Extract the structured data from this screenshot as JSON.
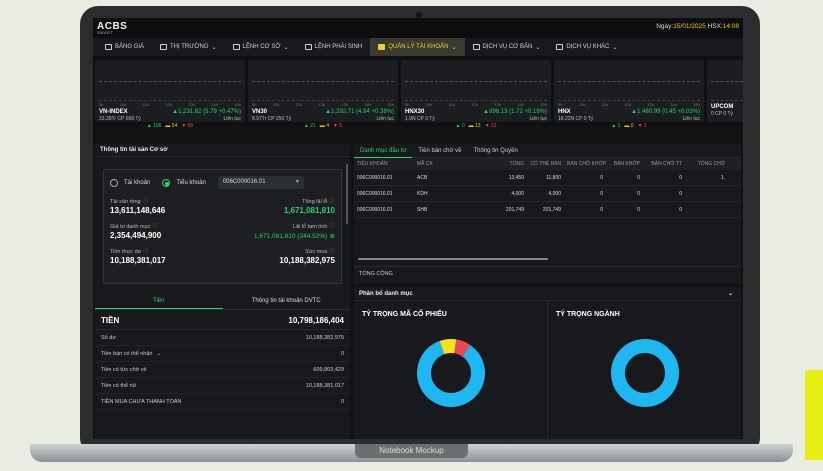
{
  "mockup_label": "Notebook Mockup",
  "app": {
    "logo": "ACBS",
    "logo_sub": "SMART"
  },
  "header": {
    "date_prefix": "Ngày:",
    "date": "15/01/2025",
    "exchange": "HSX:",
    "time": "14:08"
  },
  "nav": [
    {
      "label": "BẢNG GIÁ",
      "icon": "monitor-icon"
    },
    {
      "label": "THỊ TRƯỜNG",
      "icon": "chart-icon",
      "dropdown": true
    },
    {
      "label": "LỆNH CƠ SỞ",
      "icon": "trend-icon",
      "dropdown": true
    },
    {
      "label": "LỆNH PHÁI SINH",
      "icon": "trend-icon"
    },
    {
      "label": "QUẢN LÝ TÀI KHOẢN",
      "icon": "folder-icon",
      "dropdown": true,
      "active": true
    },
    {
      "label": "DỊCH VỤ CƠ BẢN",
      "icon": "grid-icon",
      "dropdown": true
    },
    {
      "label": "DỊCH VỤ KHÁC",
      "icon": "service-icon",
      "dropdown": true
    }
  ],
  "indices": [
    {
      "name": "VN-INDEX",
      "change": "▲1,231.82 (5.79 +0.47%)",
      "vol": "33.39Tr CP",
      "value": "668 Tỷ",
      "session": "Liên tục",
      "up": "196",
      "ref": "54",
      "down": "85",
      "ticks": [
        "9h",
        "10h",
        "11h",
        "12h",
        "13h",
        "14h",
        "15h"
      ]
    },
    {
      "name": "VN30",
      "change": "▲1,292.71 (4.94 +0.38%)",
      "vol": "8.97Tr CP",
      "value": "250 Tỷ",
      "session": "Liên tục",
      "up": "21",
      "ref": "4",
      "down": "5",
      "ticks": [
        "9h",
        "10h",
        "11h",
        "12h",
        "13h",
        "14h",
        "15h"
      ]
    },
    {
      "name": "HNX30",
      "change": "▲896.13 (1.72 +0.19%)",
      "vol": "1.9N CP",
      "value": "0 Tỷ",
      "session": "Liên tục",
      "up": "0",
      "ref": "13",
      "down": "12",
      "ticks": [
        "9h",
        "10h",
        "11h",
        "12h",
        "13h",
        "14h",
        "15h"
      ]
    },
    {
      "name": "HNX",
      "change": "▲1,460.99 (0.45 +0.03%)",
      "vol": "18.22N CP",
      "value": "0 Tỷ",
      "session": "Liên tục",
      "up": "1",
      "ref": "0",
      "down": "3",
      "ticks": [
        "9h",
        "10h",
        "11h",
        "12h",
        "13h",
        "14h",
        "15h"
      ]
    },
    {
      "name": "UPCOM",
      "change": "",
      "vol": "0 CP",
      "value": "0 Tỷ",
      "session": "",
      "up": "",
      "ref": "",
      "down": "",
      "ticks": []
    }
  ],
  "asset_panel": {
    "title": "Thông tin tài sản Cơ sở",
    "radio_account": "Tài khoản",
    "radio_subaccount": "Tiểu khoản",
    "account_value": "006C000016.01",
    "net_assets_label": "Tài sản ròng",
    "net_assets": "13,611,148,646",
    "total_pl_label": "Tổng lãi lỗ",
    "total_pl": "1,671,081,810",
    "portfolio_label": "Giá trị danh mục",
    "portfolio": "2,354,494,900",
    "temp_pl_label": "Lãi lỗ tạm tính",
    "temp_pl": "1,671,081,810 (244.52%)",
    "cash_label": "Tiền thực dư",
    "cash": "10,188,381,017",
    "buying_power_label": "Sức mua",
    "buying_power": "10,188,382,975",
    "tabs": [
      "Tiền",
      "Thông tin tài khoản DVTC"
    ],
    "money_title": "TIỀN",
    "money_total": "10,798,186,404",
    "rows": [
      {
        "label": "Số dư",
        "value": "10,188,382,975"
      },
      {
        "label": "Tiền bán có thể nhận",
        "value": "0",
        "expand": true
      },
      {
        "label": "Tiền có tức chờ về",
        "value": "609,803,429"
      },
      {
        "label": "Tiền có thể rút",
        "value": "10,188,381,017"
      },
      {
        "label": "TIỀN MUA CHƯA THANH TOÁN",
        "value": "0"
      }
    ]
  },
  "portfolio_panel": {
    "tabs": [
      "Danh mục đầu tư",
      "Tiền bán chờ về",
      "Thông tin Quyền"
    ],
    "headers": [
      "TIỂU KHOẢN",
      "MÃ CK",
      "TỔNG",
      "CÓ THỂ BÁN",
      "BÁN CHỜ KHỚP",
      "BÁN KHỚP",
      "BÁN CHỜ TT",
      "TỔNG CHỜ"
    ],
    "rows": [
      [
        "006C000016.01",
        "ACB",
        "13,450",
        "11,800",
        "0",
        "0",
        "0",
        "1,"
      ],
      [
        "006C000016.01",
        "KDH",
        "4,000",
        "4,000",
        "0",
        "0",
        "0",
        ""
      ],
      [
        "006C000016.01",
        "SHB",
        "201,749",
        "201,749",
        "0",
        "0",
        "0",
        ""
      ]
    ],
    "total_label": "TỔNG CỘNG"
  },
  "allocation": {
    "title": "Phân bổ danh mục",
    "stock_title": "TỶ TRỌNG MÃ CỔ PHIẾU",
    "sector_title": "TỶ TRỌNG NGÀNH",
    "stock_slices": [
      {
        "value": 85,
        "color": "#1fb7f2"
      },
      {
        "value": 8,
        "color": "#f7e11b"
      },
      {
        "value": 7,
        "color": "#e84a55"
      }
    ],
    "sector_slices": [
      {
        "value": 100,
        "color": "#1fb7f2"
      }
    ]
  },
  "colors": {
    "accent": "#27d36a",
    "highlight": "#f1d12f",
    "brand_yellow": "#e6ef14"
  }
}
